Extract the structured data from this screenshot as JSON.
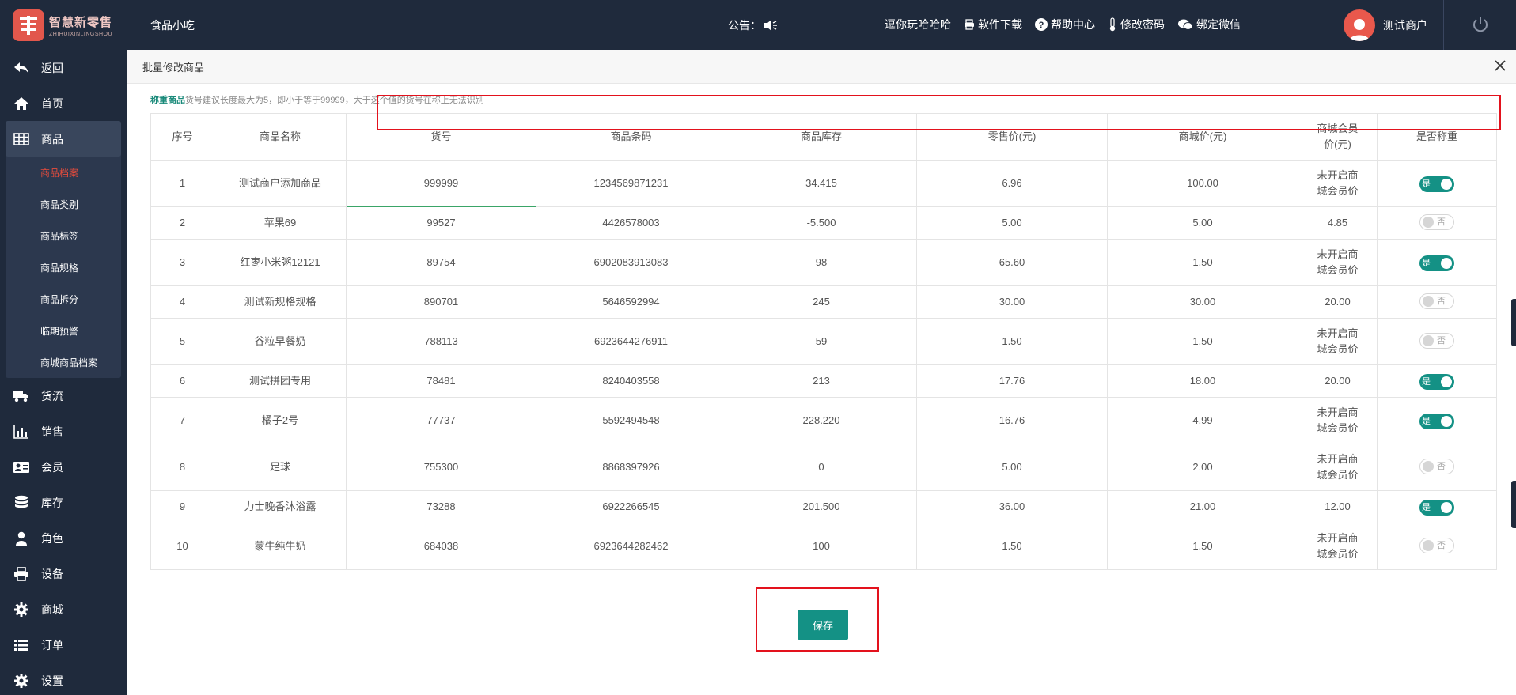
{
  "brand": {
    "name": "智慧新零售",
    "sub": "ZHIHUIXINLINGSHOU"
  },
  "header": {
    "store_name": "食品小吃",
    "notice_label": "公告：",
    "links": [
      {
        "label": "逗你玩哈哈哈"
      },
      {
        "label": "软件下载",
        "icon": "printer-icon"
      },
      {
        "label": "帮助中心",
        "icon": "question-circle-icon"
      },
      {
        "label": "修改密码",
        "icon": "thermometer-icon"
      },
      {
        "label": "绑定微信",
        "icon": "wechat-icon"
      }
    ],
    "user_name": "测试商户"
  },
  "sidebar": {
    "items": [
      {
        "label": "返回",
        "icon": "back-arrow-icon"
      },
      {
        "label": "首页",
        "icon": "home-icon"
      },
      {
        "label": "商品",
        "icon": "table-icon"
      },
      {
        "label": "货流",
        "icon": "truck-icon"
      },
      {
        "label": "销售",
        "icon": "bar-chart-icon"
      },
      {
        "label": "会员",
        "icon": "id-card-icon"
      },
      {
        "label": "库存",
        "icon": "database-icon"
      },
      {
        "label": "角色",
        "icon": "user-icon"
      },
      {
        "label": "设备",
        "icon": "printer-icon"
      },
      {
        "label": "商城",
        "icon": "gear-icon"
      },
      {
        "label": "订单",
        "icon": "list-icon"
      },
      {
        "label": "设置",
        "icon": "settings-icon"
      }
    ],
    "sub_items": [
      "商品档案",
      "商品类别",
      "商品标签",
      "商品规格",
      "商品拆分",
      "临期预警",
      "商城商品档案"
    ]
  },
  "panel": {
    "title": "批量修改商品",
    "hint_bold": "称重商品",
    "hint_text": "货号建议长度最大为5，即小于等于99999，大于这个值的货号在称上无法识别",
    "columns": [
      "序号",
      "商品名称",
      "货号",
      "商品条码",
      "商品库存",
      "零售价(元)",
      "商城价(元)",
      "商城会员价(元)",
      "是否称重"
    ],
    "rows": [
      {
        "no": "1",
        "name": "测试商户添加商品",
        "code": "999999",
        "barcode": "1234569871231",
        "stock": "34.415",
        "retail": "6.96",
        "mall": "100.00",
        "member": "未开启商城会员价",
        "weigh": "是"
      },
      {
        "no": "2",
        "name": "苹果69",
        "code": "99527",
        "barcode": "4426578003",
        "stock": "-5.500",
        "retail": "5.00",
        "mall": "5.00",
        "member": "4.85",
        "weigh": "否"
      },
      {
        "no": "3",
        "name": "红枣小米粥12121",
        "code": "89754",
        "barcode": "6902083913083",
        "stock": "98",
        "retail": "65.60",
        "mall": "1.50",
        "member": "未开启商城会员价",
        "weigh": "是"
      },
      {
        "no": "4",
        "name": "测试新规格规格",
        "code": "890701",
        "barcode": "5646592994",
        "stock": "245",
        "retail": "30.00",
        "mall": "30.00",
        "member": "20.00",
        "weigh": "否"
      },
      {
        "no": "5",
        "name": "谷粒早餐奶",
        "code": "788113",
        "barcode": "6923644276911",
        "stock": "59",
        "retail": "1.50",
        "mall": "1.50",
        "member": "未开启商城会员价",
        "weigh": "否"
      },
      {
        "no": "6",
        "name": "测试拼团专用",
        "code": "78481",
        "barcode": "8240403558",
        "stock": "213",
        "retail": "17.76",
        "mall": "18.00",
        "member": "20.00",
        "weigh": "是"
      },
      {
        "no": "7",
        "name": "橘子2号",
        "code": "77737",
        "barcode": "5592494548",
        "stock": "228.220",
        "retail": "16.76",
        "mall": "4.99",
        "member": "未开启商城会员价",
        "weigh": "是"
      },
      {
        "no": "8",
        "name": "足球",
        "code": "755300",
        "barcode": "8868397926",
        "stock": "0",
        "retail": "5.00",
        "mall": "2.00",
        "member": "未开启商城会员价",
        "weigh": "否"
      },
      {
        "no": "9",
        "name": "力士晚香沐浴露",
        "code": "73288",
        "barcode": "6922266545",
        "stock": "201.500",
        "retail": "36.00",
        "mall": "21.00",
        "member": "12.00",
        "weigh": "是"
      },
      {
        "no": "10",
        "name": "蒙牛纯牛奶",
        "code": "684038",
        "barcode": "6923644282462",
        "stock": "100",
        "retail": "1.50",
        "mall": "1.50",
        "member": "未开启商城会员价",
        "weigh": "否"
      }
    ],
    "save_label": "保存"
  },
  "colors": {
    "topbar": "#1f2a3c",
    "accent": "#149185",
    "active_sub": "#e74c3c",
    "highlight": "#e3121d"
  }
}
